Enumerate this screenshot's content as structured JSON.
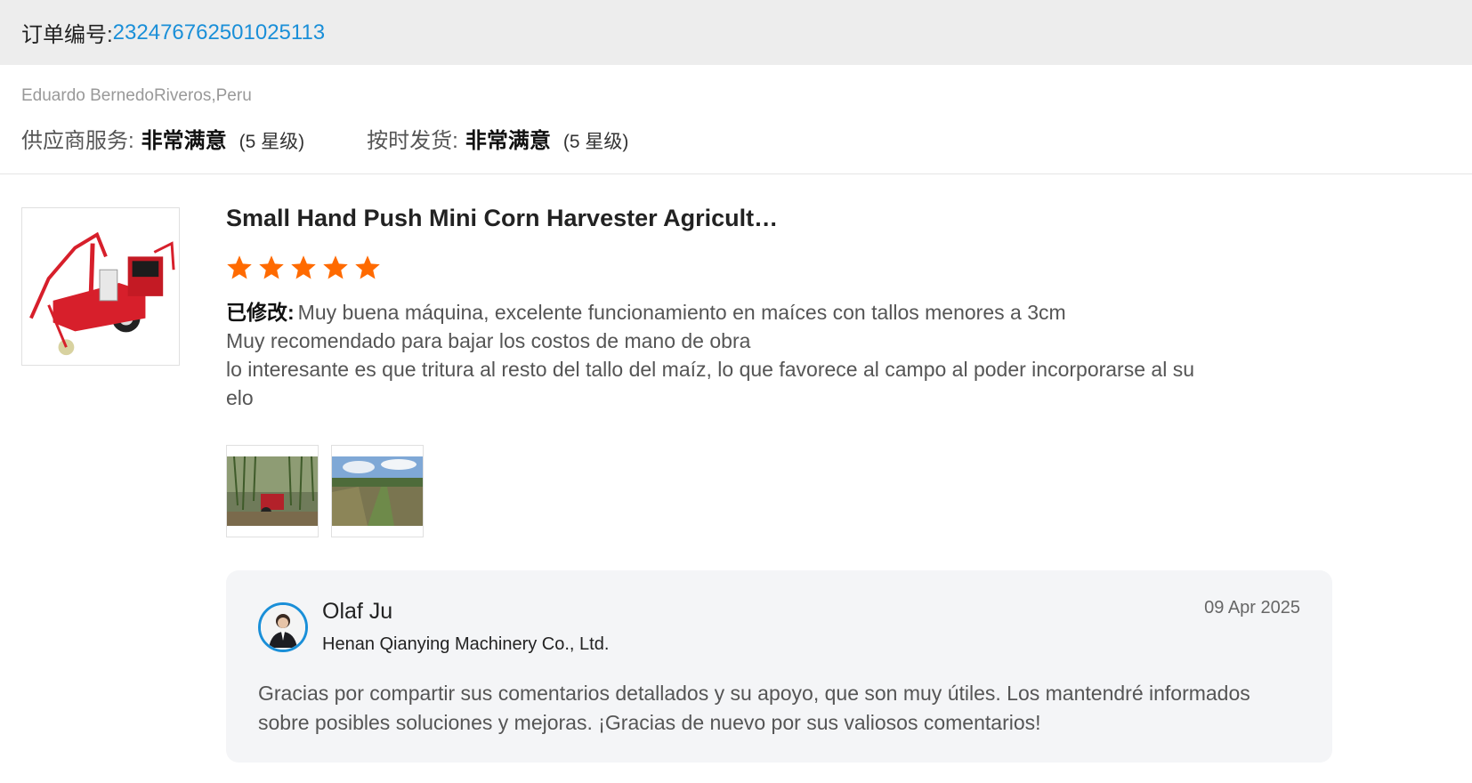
{
  "order": {
    "label": "订单编号:",
    "number": "232476762501025113"
  },
  "reviewer": {
    "name_country": "Eduardo BernedoRiveros,Peru"
  },
  "ratings": [
    {
      "label": "供应商服务:",
      "value": "非常满意",
      "stars_note": "(5 星级)"
    },
    {
      "label": "按时发货:",
      "value": "非常满意",
      "stars_note": "(5 星级)"
    }
  ],
  "product": {
    "title": "Small Hand Push Mini Corn Harvester Agricult…",
    "image_icon": "corn-harvester-image",
    "rating": 5,
    "rating_max": 5,
    "star_color": "#ff6a00"
  },
  "review": {
    "modified_label": "已修改:",
    "text": "Muy buena máquina, excelente funcionamiento en maíces con tallos menores a 3cm\nMuy recomendado para bajar los costos de mano de obra\nlo interesante es que tritura al resto del tallo del maíz, lo que favorece al campo al poder incorporarse al su\nelo"
  },
  "photos": [
    {
      "icon": "cornfield-harvester-photo"
    },
    {
      "icon": "cleared-field-photo"
    }
  ],
  "reply": {
    "name": "Olaf Ju",
    "company": "Henan Qianying Machinery Co., Ltd.",
    "date": "09 Apr 2025",
    "text": "Gracias por compartir sus comentarios detallados y su apoyo, que son muy útiles. Los mantendré informados sobre posibles soluciones y mejoras. ¡Gracias de nuevo por sus valiosos comentarios!",
    "avatar_icon": "person-avatar",
    "accent_color": "#1a8fd8"
  }
}
